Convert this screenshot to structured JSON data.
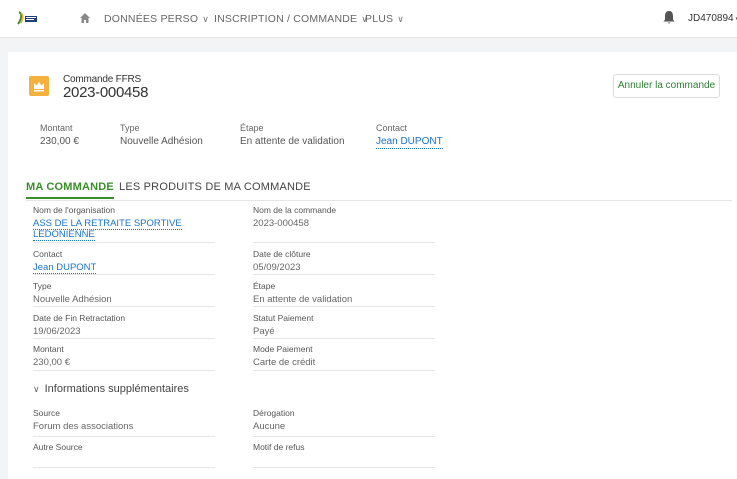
{
  "nav": {
    "items": [
      {
        "label": "DONNÉES PERSO"
      },
      {
        "label": "INSCRIPTION / COMMANDE"
      },
      {
        "label": "PLUS"
      }
    ],
    "chevron": "∨",
    "user": "JD470894",
    "user_caret": "▾"
  },
  "header": {
    "subtitle": "Commande FFRS",
    "title": "2023-000458",
    "cancel_label": "Annuler la commande"
  },
  "summary": {
    "montant_label": "Montant",
    "montant_value": "230,00 €",
    "type_label": "Type",
    "type_value": "Nouvelle Adhésion",
    "etape_label": "Étape",
    "etape_value": "En attente de validation",
    "contact_label": "Contact",
    "contact_value": "Jean DUPONT"
  },
  "tabs": [
    {
      "label": "MA COMMANDE"
    },
    {
      "label": "LES PRODUITS DE MA COMMANDE"
    }
  ],
  "fields": {
    "org_label": "Nom de l'organisation",
    "org_value_line1": "ASS DE LA RETRAITE SPORTIVE",
    "org_value_line2": "LEDONIENNE",
    "cmd_label": "Nom de la commande",
    "cmd_value": "2023-000458",
    "contact_label": "Contact",
    "contact_value": "Jean DUPONT",
    "cloture_label": "Date de clôture",
    "cloture_value": "05/09/2023",
    "type_label": "Type",
    "type_value": "Nouvelle Adhésion",
    "etape_label": "Étape",
    "etape_value": "En attente de validation",
    "retract_label": "Date de Fin Retractation",
    "retract_value": "19/06/2023",
    "statut_label": "Statut Paiement",
    "statut_value": "Payé",
    "montant_label": "Montant",
    "montant_value": "230,00 €",
    "mode_label": "Mode Paiement",
    "mode_value": "Carte de crédit"
  },
  "extra": {
    "section_label": "Informations supplémentaires",
    "section_chevron": "∨",
    "source_label": "Source",
    "source_value": "Forum des associations",
    "derogation_label": "Dérogation",
    "derogation_value": "Aucune",
    "autre_label": "Autre Source",
    "autre_value": "",
    "motif_label": "Motif de refus",
    "motif_value": ""
  },
  "colors": {
    "accent_green": "#3a8f2a",
    "link_blue": "#1a73c9",
    "icon_orange": "#f4b13d"
  }
}
